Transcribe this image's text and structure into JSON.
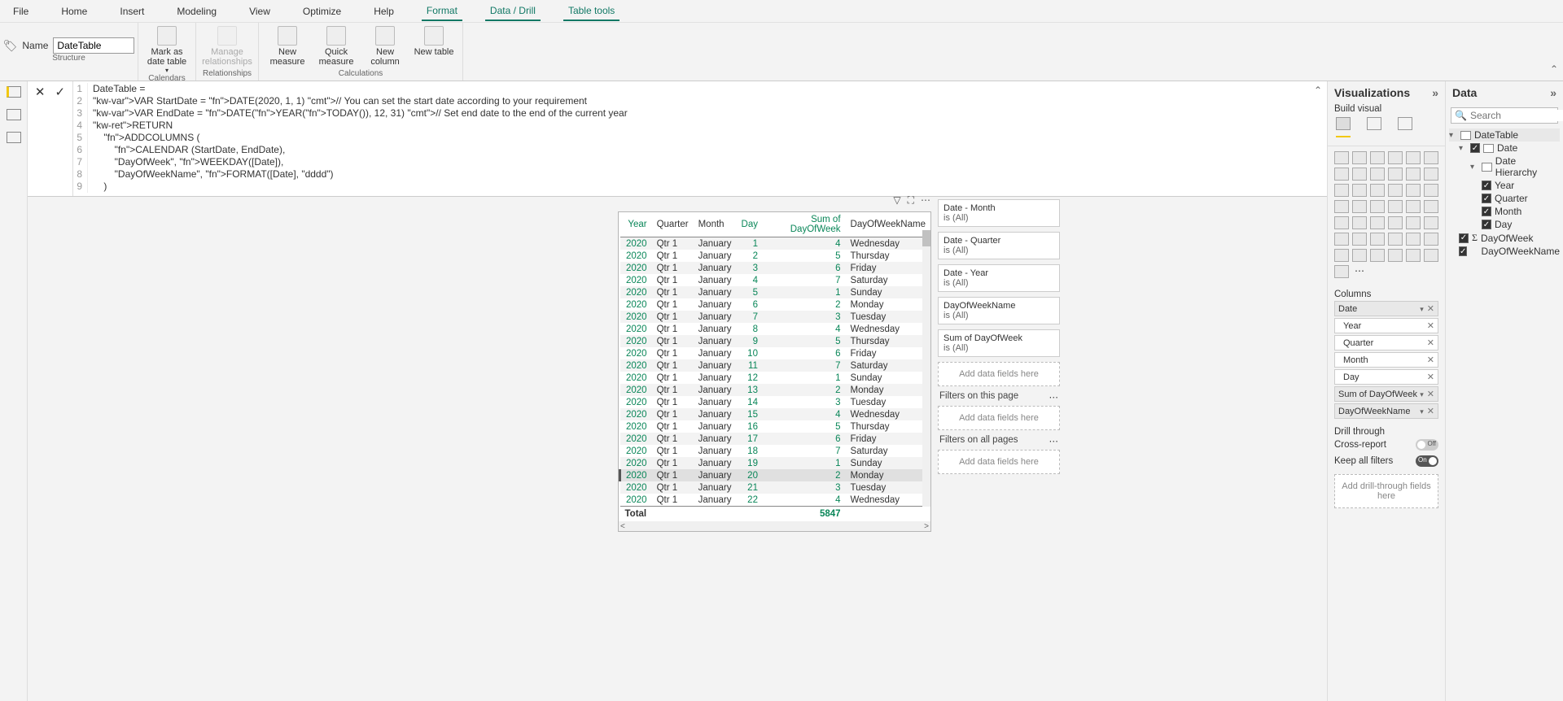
{
  "menu": {
    "tabs": [
      "File",
      "Home",
      "Insert",
      "Modeling",
      "View",
      "Optimize",
      "Help",
      "Format",
      "Data / Drill",
      "Table tools"
    ],
    "active": [
      7,
      8,
      9
    ]
  },
  "ribbon": {
    "name_label": "Name",
    "name_value": "DateTable",
    "groups": {
      "structure": "Structure",
      "calendars": "Calendars",
      "relationships": "Relationships",
      "calculations": "Calculations"
    },
    "buttons": {
      "mark_date": "Mark as date table",
      "manage_rel": "Manage relationships",
      "new_measure": "New measure",
      "quick_measure": "Quick measure",
      "new_column": "New column",
      "new_table": "New table"
    }
  },
  "formula": {
    "lines": [
      "DateTable =",
      "VAR StartDate = DATE(2020, 1, 1) // You can set the start date according to your requirement",
      "VAR EndDate = DATE(YEAR(TODAY()), 12, 31) // Set end date to the end of the current year",
      "RETURN",
      "    ADDCOLUMNS (",
      "        CALENDAR (StartDate, EndDate),",
      "        \"DayOfWeek\", WEEKDAY([Date]),",
      "        \"DayOfWeekName\", FORMAT([Date], \"dddd\")",
      "    )"
    ]
  },
  "table": {
    "headers": [
      "Year",
      "Quarter",
      "Month",
      "Day",
      "Sum of DayOfWeek",
      "DayOfWeekName"
    ],
    "rows": [
      [
        "2020",
        "Qtr 1",
        "January",
        "1",
        "4",
        "Wednesday"
      ],
      [
        "2020",
        "Qtr 1",
        "January",
        "2",
        "5",
        "Thursday"
      ],
      [
        "2020",
        "Qtr 1",
        "January",
        "3",
        "6",
        "Friday"
      ],
      [
        "2020",
        "Qtr 1",
        "January",
        "4",
        "7",
        "Saturday"
      ],
      [
        "2020",
        "Qtr 1",
        "January",
        "5",
        "1",
        "Sunday"
      ],
      [
        "2020",
        "Qtr 1",
        "January",
        "6",
        "2",
        "Monday"
      ],
      [
        "2020",
        "Qtr 1",
        "January",
        "7",
        "3",
        "Tuesday"
      ],
      [
        "2020",
        "Qtr 1",
        "January",
        "8",
        "4",
        "Wednesday"
      ],
      [
        "2020",
        "Qtr 1",
        "January",
        "9",
        "5",
        "Thursday"
      ],
      [
        "2020",
        "Qtr 1",
        "January",
        "10",
        "6",
        "Friday"
      ],
      [
        "2020",
        "Qtr 1",
        "January",
        "11",
        "7",
        "Saturday"
      ],
      [
        "2020",
        "Qtr 1",
        "January",
        "12",
        "1",
        "Sunday"
      ],
      [
        "2020",
        "Qtr 1",
        "January",
        "13",
        "2",
        "Monday"
      ],
      [
        "2020",
        "Qtr 1",
        "January",
        "14",
        "3",
        "Tuesday"
      ],
      [
        "2020",
        "Qtr 1",
        "January",
        "15",
        "4",
        "Wednesday"
      ],
      [
        "2020",
        "Qtr 1",
        "January",
        "16",
        "5",
        "Thursday"
      ],
      [
        "2020",
        "Qtr 1",
        "January",
        "17",
        "6",
        "Friday"
      ],
      [
        "2020",
        "Qtr 1",
        "January",
        "18",
        "7",
        "Saturday"
      ],
      [
        "2020",
        "Qtr 1",
        "January",
        "19",
        "1",
        "Sunday"
      ],
      [
        "2020",
        "Qtr 1",
        "January",
        "20",
        "2",
        "Monday"
      ],
      [
        "2020",
        "Qtr 1",
        "January",
        "21",
        "3",
        "Tuesday"
      ],
      [
        "2020",
        "Qtr 1",
        "January",
        "22",
        "4",
        "Wednesday"
      ]
    ],
    "selected_row": 19,
    "total_label": "Total",
    "total_value": "5847"
  },
  "filters": {
    "cards": [
      {
        "name": "Date - Month",
        "state": "is (All)"
      },
      {
        "name": "Date - Quarter",
        "state": "is (All)"
      },
      {
        "name": "Date - Year",
        "state": "is (All)"
      },
      {
        "name": "DayOfWeekName",
        "state": "is (All)"
      },
      {
        "name": "Sum of DayOfWeek",
        "state": "is (All)"
      }
    ],
    "add_here": "Add data fields here",
    "page_title": "Filters on this page",
    "all_title": "Filters on all pages"
  },
  "viz": {
    "title": "Visualizations",
    "build": "Build visual",
    "columns_label": "Columns",
    "wells": {
      "date": "Date",
      "year": "Year",
      "quarter": "Quarter",
      "month": "Month",
      "day": "Day",
      "sum_dow": "Sum of DayOfWeek",
      "down": "DayOfWeekName"
    },
    "drill": {
      "title": "Drill through",
      "cross": "Cross-report",
      "keep": "Keep all filters",
      "off": "Off",
      "on": "On",
      "add": "Add drill-through fields here"
    }
  },
  "data": {
    "title": "Data",
    "search_placeholder": "Search",
    "tree": {
      "table": "DateTable",
      "date": "Date",
      "hierarchy": "Date Hierarchy",
      "year": "Year",
      "quarter": "Quarter",
      "month": "Month",
      "day": "Day",
      "dow": "DayOfWeek",
      "down": "DayOfWeekName"
    }
  }
}
